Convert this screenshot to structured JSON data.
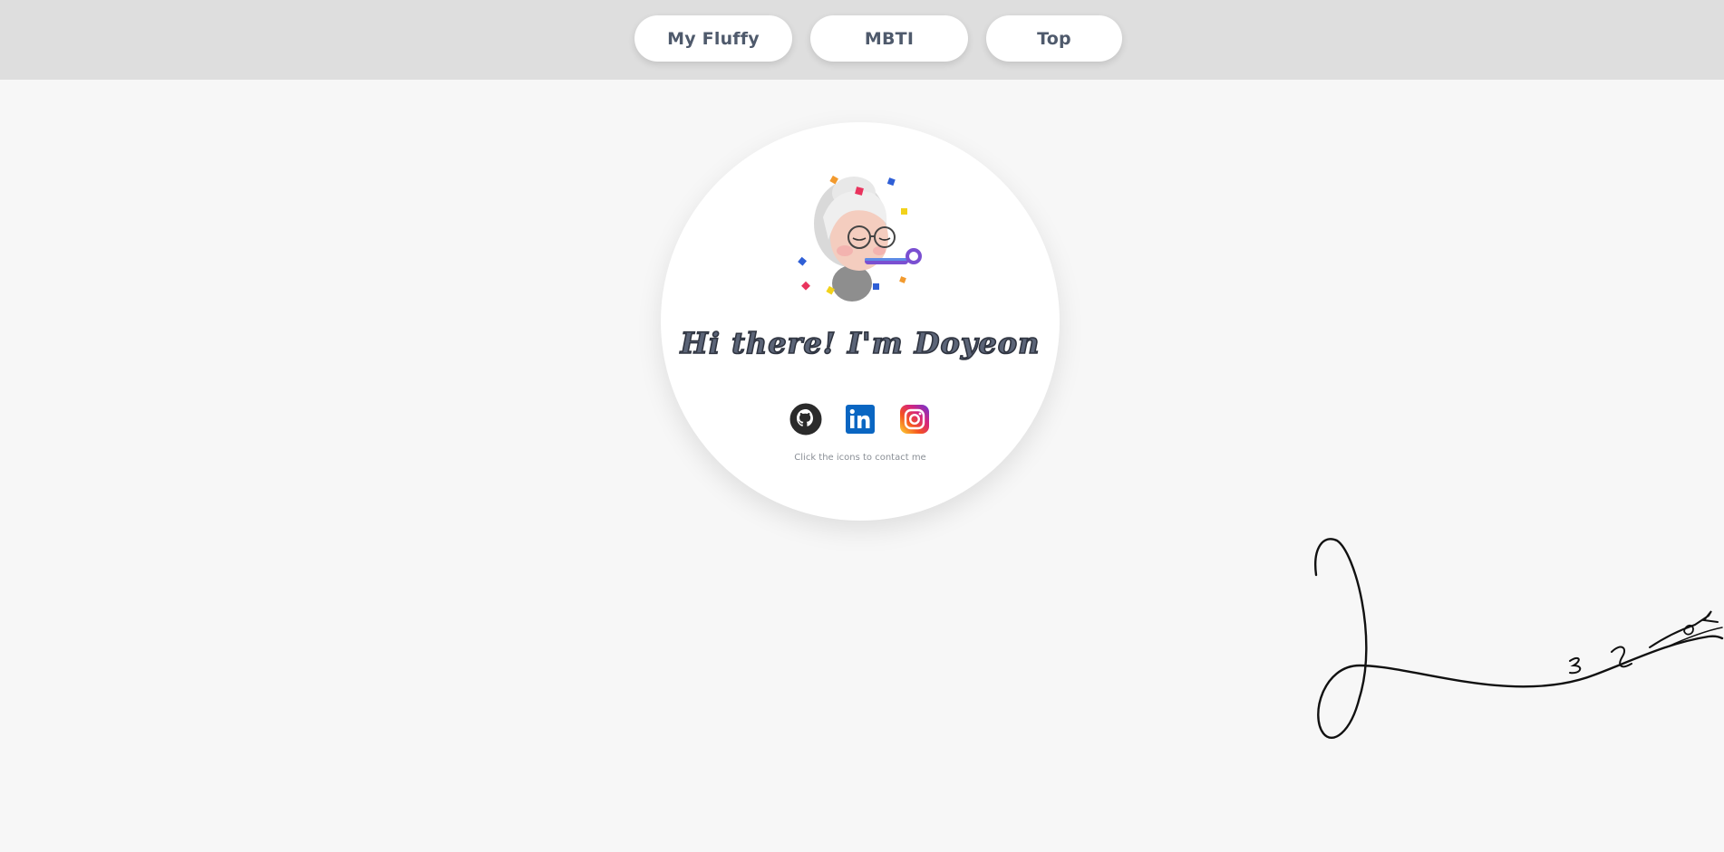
{
  "nav": {
    "my_fluffy": "My Fluffy",
    "mbti": "MBTI",
    "top": "Top"
  },
  "profile": {
    "greeting": "Hi there! I'm Doyeon",
    "hint": "Click the icons to contact me",
    "avatar_icon": "memoji-party-icon"
  },
  "social": {
    "icons": [
      "github-icon",
      "linkedin-icon",
      "instagram-icon"
    ]
  },
  "signature": {
    "icon": "handwritten-signature"
  },
  "colors": {
    "background": "#f7f7f7",
    "topbar": "#dedede",
    "button_text": "#4f5a6c",
    "linkedin": "#0a66c2"
  }
}
